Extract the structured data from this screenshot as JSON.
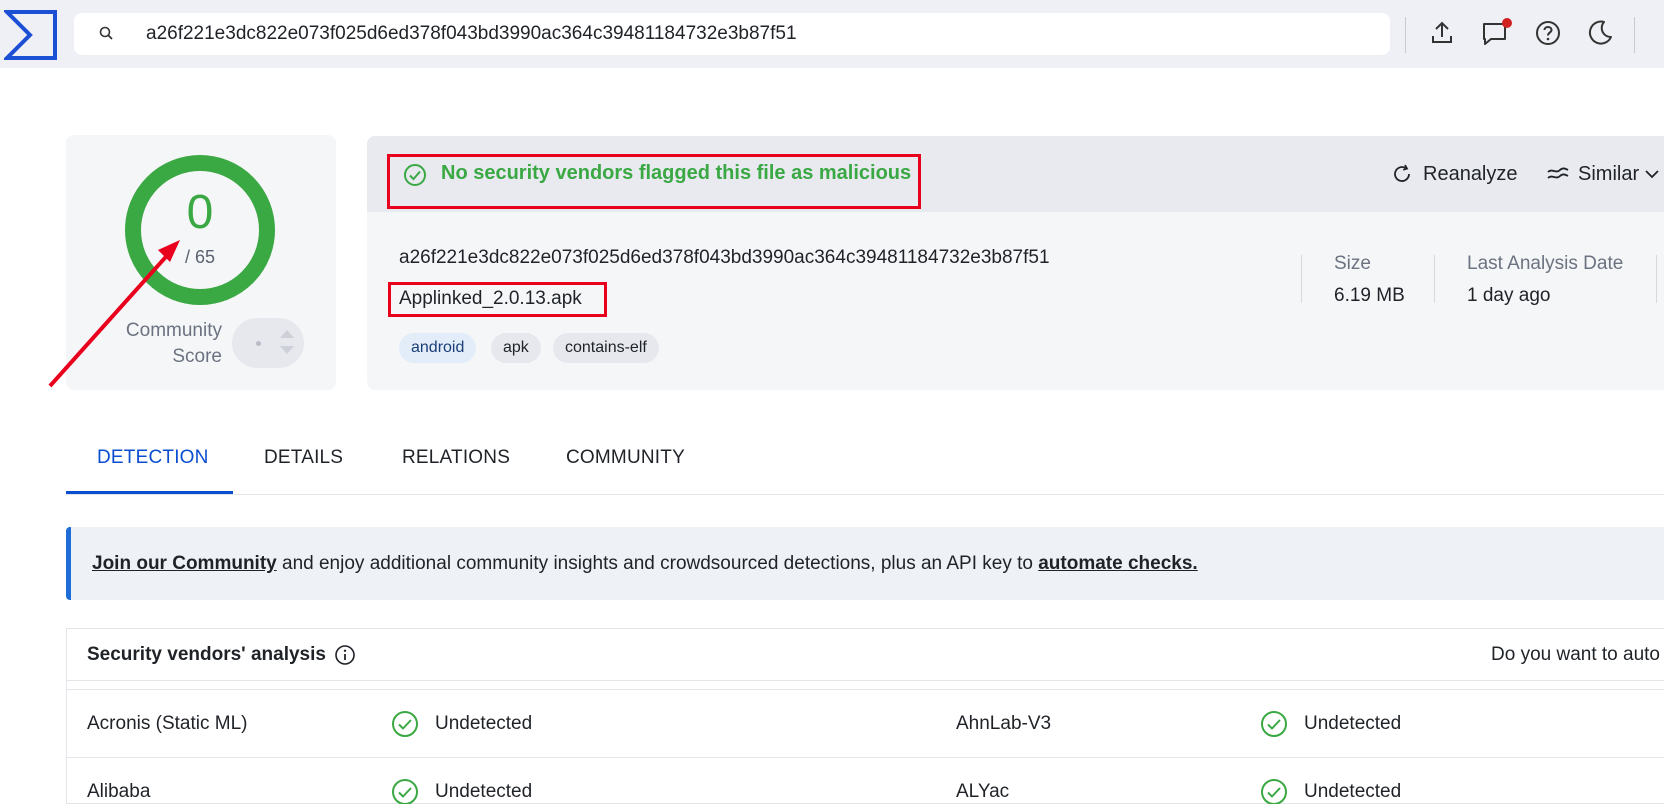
{
  "topbar": {
    "logo": "virustotal-sigma-logo",
    "search_value": "a26f221e3dc822e073f025d6ed378f043bd3990ac364c39481184732e3b87f51",
    "icons": [
      "upload-icon",
      "chat-icon",
      "help-icon",
      "moon-icon"
    ],
    "notification_dot_color": "#d21f1f"
  },
  "score": {
    "detections": "0",
    "total": "/ 65",
    "community_label": "Community Score",
    "ring_color": "#3aa843"
  },
  "summary": {
    "verdict": "No security vendors flagged this file as malicious",
    "verdict_color": "#3aa843",
    "reanalyze_label": "Reanalyze",
    "similar_label": "Similar",
    "hash": "a26f221e3dc822e073f025d6ed378f043bd3990ac364c39481184732e3b87f51",
    "filename": "Applinked_2.0.13.apk",
    "tags": [
      "android",
      "apk",
      "contains-elf"
    ],
    "size_label": "Size",
    "size_value": "6.19 MB",
    "date_label": "Last Analysis Date",
    "date_value": "1 day ago"
  },
  "tabs": [
    "DETECTION",
    "DETAILS",
    "RELATIONS",
    "COMMUNITY"
  ],
  "active_tab": "DETECTION",
  "banner": {
    "link1": "Join our Community",
    "middle": " and enjoy additional community insights and crowdsourced detections, plus an API key to ",
    "link2": "automate checks."
  },
  "vendors": {
    "title": "Security vendors' analysis",
    "ask": "Do you want to auto",
    "rows": [
      [
        {
          "name": "Acronis (Static ML)",
          "status": "Undetected"
        },
        {
          "name": "AhnLab-V3",
          "status": "Undetected"
        }
      ],
      [
        {
          "name": "Alibaba",
          "status": "Undetected"
        },
        {
          "name": "ALYac",
          "status": "Undetected"
        }
      ]
    ]
  },
  "annotation_color": "#e8001c"
}
